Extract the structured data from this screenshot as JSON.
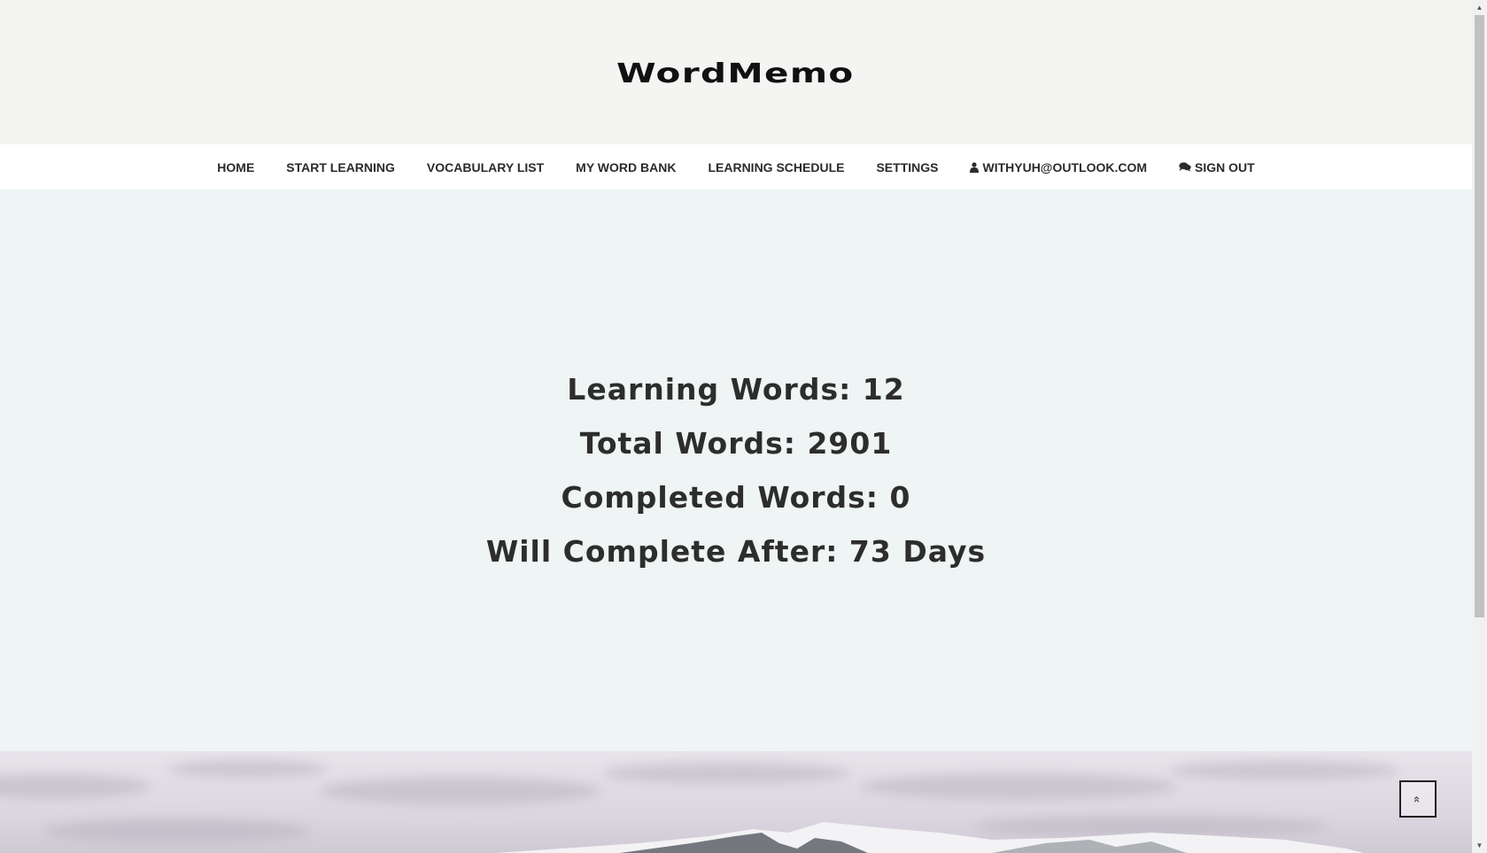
{
  "header": {
    "logo_text": "WordMemo"
  },
  "nav": {
    "items": [
      {
        "label": "HOME"
      },
      {
        "label": "START LEARNING"
      },
      {
        "label": "VOCABULARY LIST"
      },
      {
        "label": "MY WORD BANK"
      },
      {
        "label": "LEARNING SCHEDULE"
      },
      {
        "label": "SETTINGS"
      },
      {
        "label": "WITHYUH@OUTLOOK.COM",
        "icon": "user-icon"
      },
      {
        "label": "SIGN OUT",
        "icon": "comments-icon"
      }
    ]
  },
  "stats": {
    "learning": "Learning Words: 12",
    "total": "Total Words: 2901",
    "completed": "Completed Words: 0",
    "eta": "Will Complete After: 73 Days"
  },
  "scroll_top": {
    "icon": "double-chevron-up-icon",
    "glyph": "«"
  },
  "colors": {
    "header_bg": "#f4f4f2",
    "nav_bg": "#ffffff",
    "stats_bg": "#eff4f4",
    "text": "#2d2d2d"
  }
}
